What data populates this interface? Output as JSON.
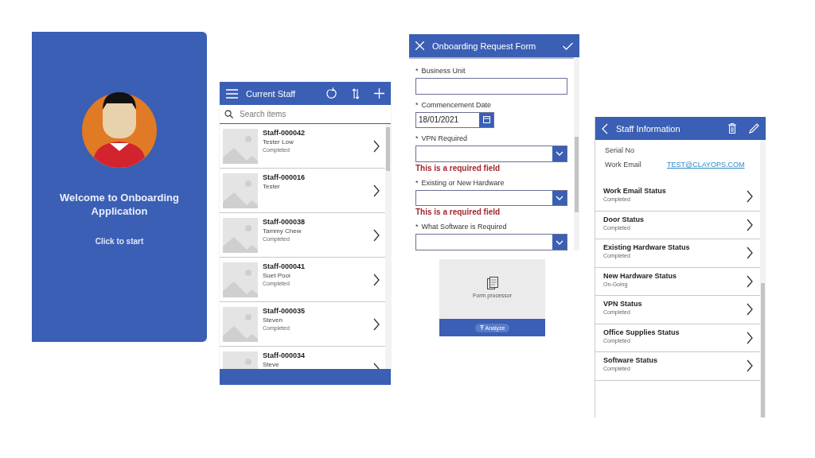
{
  "welcome_screen": {
    "title": "Welcome to Onboarding Application",
    "action": "Click to start"
  },
  "staff_list_screen": {
    "title": "Current Staff",
    "search": {
      "placeholder": "Search items"
    },
    "items": [
      {
        "id": "Staff-000042",
        "name": "Tester Low",
        "status": "Completed"
      },
      {
        "id": "Staff-000016",
        "name": "Tester"
      },
      {
        "id": "Staff-000038",
        "name": "Tammy Chew",
        "status": "Completed"
      },
      {
        "id": "Staff-000041",
        "name": "Suet Pooi",
        "status": "Completed"
      },
      {
        "id": "Staff-000035",
        "name": "Steven",
        "status": "Completed"
      },
      {
        "id": "Staff-000034",
        "name": "Steve"
      }
    ]
  },
  "form_screen": {
    "title": "Onboarding Request Form",
    "fields": [
      {
        "kind": "text",
        "label": "Business Unit"
      },
      {
        "kind": "date",
        "label": "Commencement Date",
        "value": "18/01/2021"
      },
      {
        "kind": "dropdown",
        "label": "VPN Required",
        "error": "This is a required field"
      },
      {
        "kind": "dropdown",
        "label": "Existing or New Hardware",
        "error": "This is a required field"
      },
      {
        "kind": "dropdown",
        "label": "What Software is Required"
      }
    ],
    "required_mark": "*",
    "form_processor": {
      "caption": "Form processor",
      "button": "Analyze"
    }
  },
  "staff_info_screen": {
    "title": "Staff Information",
    "details": [
      {
        "label": "Serial No"
      },
      {
        "label": "Work Email",
        "value": "TEST@CLAYOPS.COM"
      }
    ],
    "statuses": [
      {
        "name": "Work Email Status",
        "status": "Completed"
      },
      {
        "name": "Door Status",
        "status": "Completed"
      },
      {
        "name": "Existing Hardware Status",
        "status": "Completed"
      },
      {
        "name": "New Hardware Status",
        "status": "On-Going"
      },
      {
        "name": "VPN Status",
        "status": "Completed"
      },
      {
        "name": "Office Supplies Status",
        "status": "Completed"
      },
      {
        "name": "Software Status",
        "status": "Completed"
      }
    ]
  }
}
